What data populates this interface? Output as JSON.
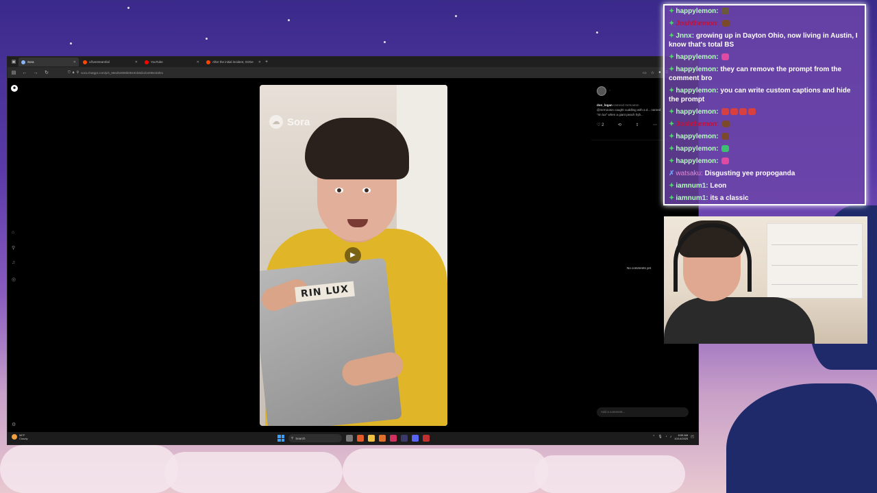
{
  "browser": {
    "tabs": [
      {
        "title": "Sora",
        "favicon_color": "#8ab4f8",
        "active": true
      },
      {
        "title": "c/livestreamfail",
        "favicon_color": "#ff4500",
        "active": false
      },
      {
        "title": "YouTube",
        "favicon_color": "#ff0000",
        "active": false
      },
      {
        "title": "After the initial incident, O2Ge",
        "favicon_color": "#ff4500",
        "active": false
      }
    ],
    "address": "sora.chatgpt.com/p/s_68ed54659b08191b8d11b4296c5afe1"
  },
  "video": {
    "watermark": "Sora",
    "laptop_label": "RIN LUX"
  },
  "post": {
    "username": "don_logan",
    "cameo": "cameod mrmouton",
    "caption": "@mrmouton caught cuddling with a d... named \"rin lux\" when a giant peach hyb...",
    "like_count": "2",
    "no_comments": "No comments yet",
    "comment_placeholder": "Add a comment..."
  },
  "taskbar": {
    "weather_temp": "58°F",
    "weather_cond": "Cloudy",
    "search_label": "Search",
    "time": "8:55 AM",
    "date": "10/14/2025"
  },
  "chat": [
    {
      "badge": "green",
      "user": "happylemon",
      "user_style": "green",
      "text": "",
      "emotes": [
        "#6b5a3a"
      ]
    },
    {
      "badge": "green",
      "user": "Joshthemon",
      "user_style": "red",
      "text": "",
      "emotes": [
        "#7a4a2a"
      ]
    },
    {
      "badge": "green",
      "user": "Jnnx",
      "user_style": "green",
      "text": "growing up in Dayton Ohio, now living in Austin, I know that's total BS",
      "emotes": []
    },
    {
      "badge": "green",
      "user": "happylemon",
      "user_style": "green",
      "text": "",
      "emotes": [
        "#e04aa0"
      ]
    },
    {
      "badge": "green",
      "user": "happylemon",
      "user_style": "green",
      "text": "they can remove the prompt from the comment bro",
      "emotes": []
    },
    {
      "badge": "green",
      "user": "happylemon",
      "user_style": "green",
      "text": "you can write custom captions and hide the prompt",
      "emotes": []
    },
    {
      "badge": "green",
      "user": "happylemon",
      "user_style": "green",
      "text": "",
      "emotes": [
        "#d84040",
        "#d84040",
        "#d84040",
        "#d84040"
      ]
    },
    {
      "badge": "green",
      "user": "Joshthemon",
      "user_style": "red",
      "text": "",
      "emotes": [
        "#7a4a2a"
      ]
    },
    {
      "badge": "green",
      "user": "happylemon",
      "user_style": "green",
      "text": "",
      "emotes": [
        "#7a4a2a"
      ]
    },
    {
      "badge": "green",
      "user": "happylemon",
      "user_style": "green",
      "text": "",
      "emotes": [
        "#3ac070"
      ]
    },
    {
      "badge": "green",
      "user": "happylemon",
      "user_style": "green",
      "text": "",
      "emotes": [
        "#e04aa0"
      ]
    },
    {
      "badge": "blue",
      "user": "watsaku",
      "user_style": "pink",
      "text": "Disgusting yee propoganda",
      "emotes": []
    },
    {
      "badge": "green",
      "user": "iamnum1",
      "user_style": "green",
      "text": "Leon",
      "emotes": []
    },
    {
      "badge": "green",
      "user": "iamnum1",
      "user_style": "green",
      "text": "its a classic",
      "emotes": []
    }
  ]
}
